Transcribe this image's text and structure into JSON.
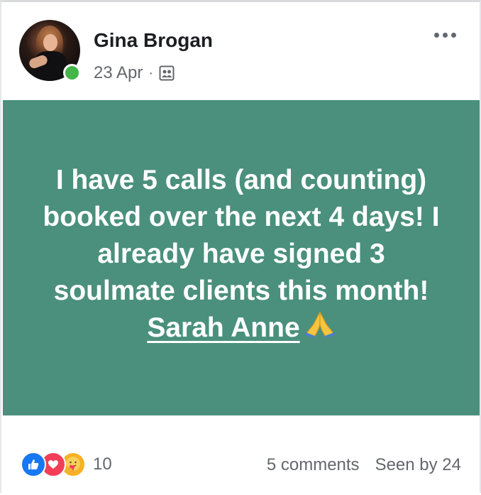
{
  "post": {
    "author": "Gina Brogan",
    "date": "23 Apr",
    "separator": "·",
    "audience_icon": "group-icon",
    "more_icon": "more-options-icon",
    "text_before": "I have 5 calls (and counting) booked over the next 4 days! I already have signed 3 soulmate clients this month! ",
    "mention": "Sarah Anne",
    "emoji": "pray-emoji",
    "background_color": "#4a907c"
  },
  "footer": {
    "reaction_icons": [
      "like-icon",
      "love-icon",
      "care-icon"
    ],
    "reaction_count": "10",
    "comments": "5 comments",
    "seen": "Seen by 24"
  },
  "colors": {
    "online": "#44b549",
    "like": "#1877f2",
    "love": "#f33e58",
    "care": "#f7b125"
  }
}
